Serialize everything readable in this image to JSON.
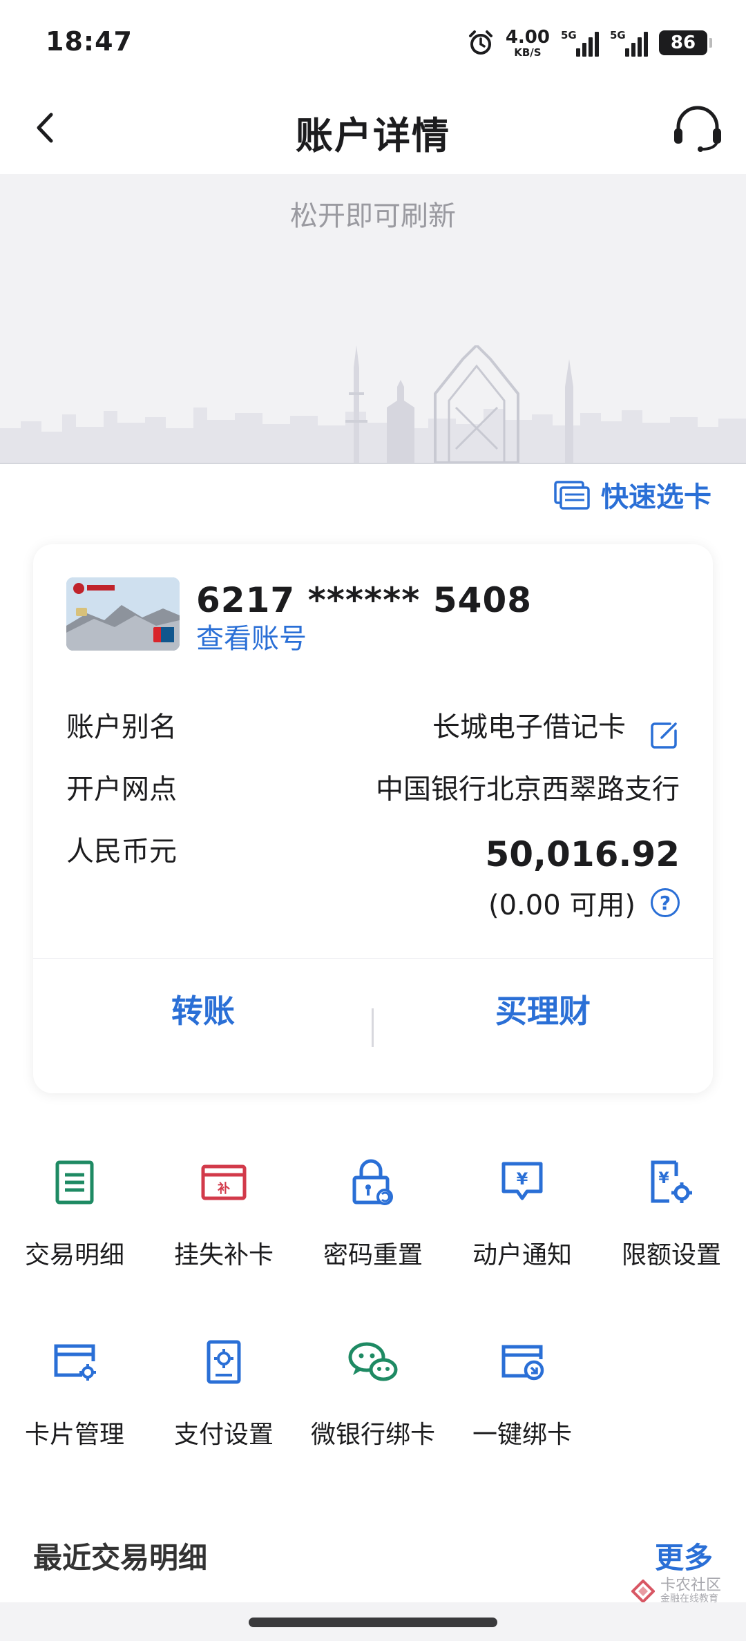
{
  "status_bar": {
    "time": "18:47",
    "net_speed_value": "4.00",
    "net_speed_unit": "KB/S",
    "signal1": "5G",
    "signal2": "5G",
    "battery": "86"
  },
  "header": {
    "title": "账户详情"
  },
  "refresh": {
    "hint": "松开即可刷新"
  },
  "quick_select_label": "快速选卡",
  "card": {
    "number": "6217 ****** 5408",
    "view_account_label": "查看账号",
    "rows": [
      {
        "label": "账户别名",
        "value": "长城电子借记卡"
      },
      {
        "label": "开户网点",
        "value": "中国银行北京西翠路支行"
      }
    ],
    "currency_label": "人民币元",
    "balance": "50,016.92",
    "available": "(0.00 可用)",
    "actions": {
      "transfer": "转账",
      "buy_wealth": "买理财"
    }
  },
  "services": [
    {
      "label": "交易明细",
      "icon": "transaction-list-icon"
    },
    {
      "label": "挂失补卡",
      "icon": "report-loss-icon"
    },
    {
      "label": "密码重置",
      "icon": "password-reset-icon"
    },
    {
      "label": "动户通知",
      "icon": "account-notice-icon"
    },
    {
      "label": "限额设置",
      "icon": "limit-settings-icon"
    },
    {
      "label": "卡片管理",
      "icon": "card-manage-icon"
    },
    {
      "label": "支付设置",
      "icon": "payment-settings-icon"
    },
    {
      "label": "微银行绑卡",
      "icon": "wechat-bind-icon"
    },
    {
      "label": "一键绑卡",
      "icon": "one-click-bind-icon"
    }
  ],
  "recent": {
    "title": "最近交易明细",
    "more": "更多"
  },
  "watermark": {
    "name": "卡农社区",
    "sub": "金融在线教育"
  },
  "colors": {
    "accent_blue": "#2a6fd6",
    "green": "#1e8a63",
    "red": "#d23a4a"
  }
}
